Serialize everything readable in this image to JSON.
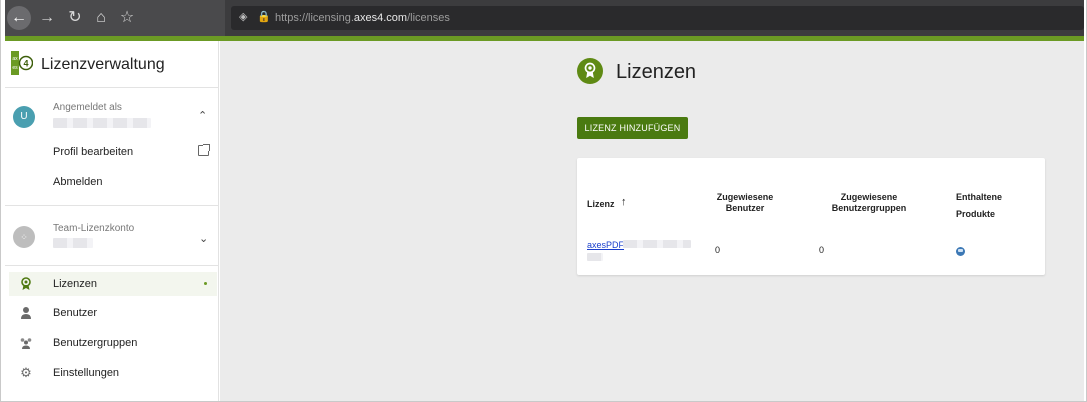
{
  "browser": {
    "url_prefix": "https://licensing.",
    "url_host": "axes4.com",
    "url_path": "/licenses"
  },
  "sidebar": {
    "app_name": "Lizenzverwaltung",
    "logged_in_label": "Angemeldet als",
    "user_initial": "U",
    "profile_edit": "Profil bearbeiten",
    "logout": "Abmelden",
    "team_account_label": "Team-Lizenzkonto",
    "nav": [
      {
        "label": "Lizenzen",
        "icon": "award-icon",
        "active": true
      },
      {
        "label": "Benutzer",
        "icon": "person-icon",
        "active": false
      },
      {
        "label": "Benutzergruppen",
        "icon": "group-icon",
        "active": false
      },
      {
        "label": "Einstellungen",
        "icon": "gear-icon",
        "active": false
      }
    ]
  },
  "main": {
    "title": "Lizenzen",
    "add_button": "LIZENZ HINZUFÜGEN",
    "table": {
      "headers": {
        "license": "Lizenz",
        "assigned_users_1": "Zugewiesene",
        "assigned_users_2": "Benutzer",
        "assigned_groups_1": "Zugewiesene",
        "assigned_groups_2": "Benutzergruppen",
        "products_1": "Enthaltene",
        "products_2": "Produkte"
      },
      "sort_indicator": "↑",
      "rows": [
        {
          "license": "axesPDF",
          "assigned_users": "0",
          "assigned_groups": "0",
          "product_icon": "product-icon"
        }
      ]
    }
  },
  "colors": {
    "accent_green": "#6b9a24",
    "button_green": "#4a7a10",
    "link_blue": "#1a3fcc",
    "main_background": "#ebebeb"
  }
}
